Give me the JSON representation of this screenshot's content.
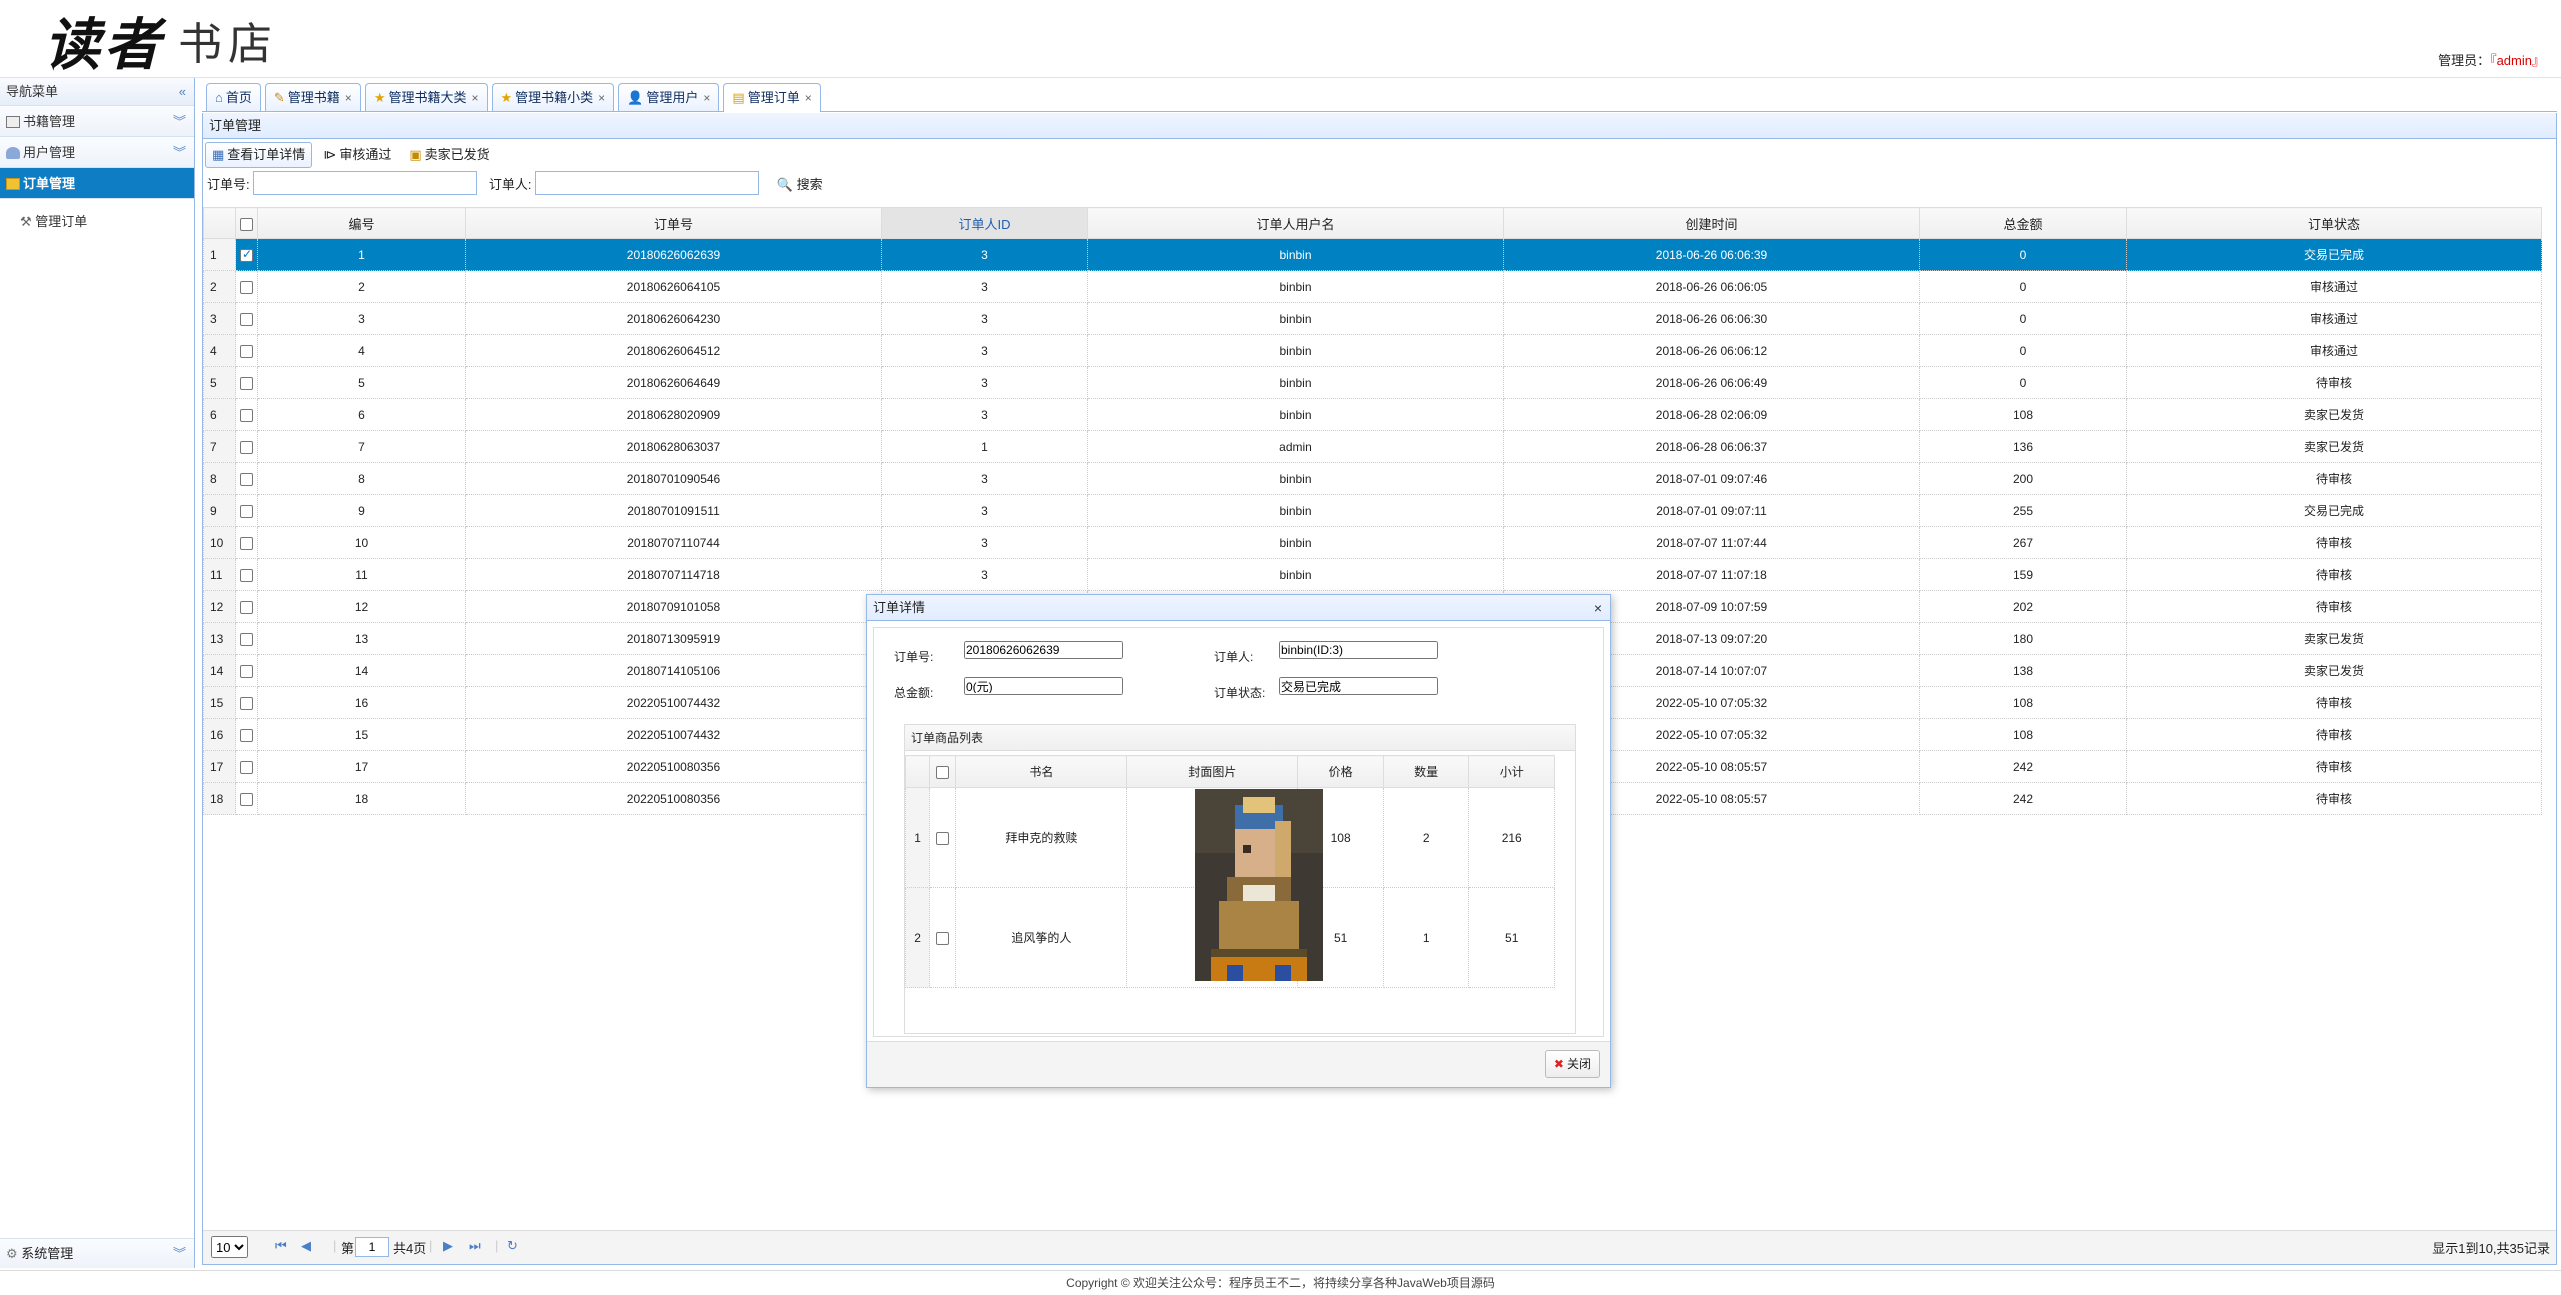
{
  "header": {
    "logo_script": "读者",
    "logo_text": "书店",
    "admin_label": "管理员：",
    "admin_name": "『admin』"
  },
  "nav": {
    "title": "导航菜单",
    "collapse_icon": "double-left-chevron-icon",
    "items": [
      {
        "label": "书籍管理",
        "icon": "book-icon",
        "active": false
      },
      {
        "label": "用户管理",
        "icon": "user-icon",
        "active": false
      },
      {
        "label": "订单管理",
        "icon": "folder-icon",
        "active": true
      }
    ],
    "sub_items": [
      {
        "label": "管理订单",
        "icon": "wrench-icon"
      }
    ],
    "bottom": "系统管理"
  },
  "tabs": [
    {
      "label": "首页",
      "icon": "home-icon",
      "closable": false
    },
    {
      "label": "管理书籍",
      "icon": "book-icon",
      "closable": true
    },
    {
      "label": "管理书籍大类",
      "icon": "star-icon",
      "closable": true
    },
    {
      "label": "管理书籍小类",
      "icon": "star-icon",
      "closable": true
    },
    {
      "label": "管理用户",
      "icon": "user-icon",
      "closable": true
    },
    {
      "label": "管理订单",
      "icon": "folder-icon",
      "closable": true,
      "active": true
    }
  ],
  "panel": {
    "title": "订单管理",
    "toolbar": {
      "view_detail": "查看订单详情",
      "approve": "审核通过",
      "shipped": "卖家已发货"
    },
    "search": {
      "order_no_label": "订单号:",
      "order_no_value": "",
      "orderer_label": "订单人:",
      "orderer_value": "",
      "search_button": "搜索"
    }
  },
  "grid": {
    "columns": [
      "编号",
      "订单号",
      "订单人ID",
      "订单人用户名",
      "创建时间",
      "总金额",
      "订单状态"
    ],
    "sorted_column": "订单人ID",
    "rows": [
      {
        "rn": "1",
        "checked": true,
        "id": "1",
        "order_no": "20180626062639",
        "user_id": "3",
        "username": "binbin",
        "created": "2018-06-26 06:06:39",
        "total": "0",
        "status": "交易已完成"
      },
      {
        "rn": "2",
        "checked": false,
        "id": "2",
        "order_no": "20180626064105",
        "user_id": "3",
        "username": "binbin",
        "created": "2018-06-26 06:06:05",
        "total": "0",
        "status": "审核通过"
      },
      {
        "rn": "3",
        "checked": false,
        "id": "3",
        "order_no": "20180626064230",
        "user_id": "3",
        "username": "binbin",
        "created": "2018-06-26 06:06:30",
        "total": "0",
        "status": "审核通过"
      },
      {
        "rn": "4",
        "checked": false,
        "id": "4",
        "order_no": "20180626064512",
        "user_id": "3",
        "username": "binbin",
        "created": "2018-06-26 06:06:12",
        "total": "0",
        "status": "审核通过"
      },
      {
        "rn": "5",
        "checked": false,
        "id": "5",
        "order_no": "20180626064649",
        "user_id": "3",
        "username": "binbin",
        "created": "2018-06-26 06:06:49",
        "total": "0",
        "status": "待审核"
      },
      {
        "rn": "6",
        "checked": false,
        "id": "6",
        "order_no": "20180628020909",
        "user_id": "3",
        "username": "binbin",
        "created": "2018-06-28 02:06:09",
        "total": "108",
        "status": "卖家已发货"
      },
      {
        "rn": "7",
        "checked": false,
        "id": "7",
        "order_no": "20180628063037",
        "user_id": "1",
        "username": "admin",
        "created": "2018-06-28 06:06:37",
        "total": "136",
        "status": "卖家已发货"
      },
      {
        "rn": "8",
        "checked": false,
        "id": "8",
        "order_no": "20180701090546",
        "user_id": "3",
        "username": "binbin",
        "created": "2018-07-01 09:07:46",
        "total": "200",
        "status": "待审核"
      },
      {
        "rn": "9",
        "checked": false,
        "id": "9",
        "order_no": "20180701091511",
        "user_id": "3",
        "username": "binbin",
        "created": "2018-07-01 09:07:11",
        "total": "255",
        "status": "交易已完成"
      },
      {
        "rn": "10",
        "checked": false,
        "id": "10",
        "order_no": "20180707110744",
        "user_id": "3",
        "username": "binbin",
        "created": "2018-07-07 11:07:44",
        "total": "267",
        "status": "待审核"
      },
      {
        "rn": "11",
        "checked": false,
        "id": "11",
        "order_no": "20180707114718",
        "user_id": "3",
        "username": "binbin",
        "created": "2018-07-07 11:07:18",
        "total": "159",
        "status": "待审核"
      },
      {
        "rn": "12",
        "checked": false,
        "id": "12",
        "order_no": "20180709101058",
        "user_id": "",
        "username": "",
        "created": "2018-07-09 10:07:59",
        "total": "202",
        "status": "待审核"
      },
      {
        "rn": "13",
        "checked": false,
        "id": "13",
        "order_no": "20180713095919",
        "user_id": "",
        "username": "",
        "created": "2018-07-13 09:07:20",
        "total": "180",
        "status": "卖家已发货"
      },
      {
        "rn": "14",
        "checked": false,
        "id": "14",
        "order_no": "20180714105106",
        "user_id": "",
        "username": "",
        "created": "2018-07-14 10:07:07",
        "total": "138",
        "status": "卖家已发货"
      },
      {
        "rn": "15",
        "checked": false,
        "id": "16",
        "order_no": "20220510074432",
        "user_id": "",
        "username": "",
        "created": "2022-05-10 07:05:32",
        "total": "108",
        "status": "待审核"
      },
      {
        "rn": "16",
        "checked": false,
        "id": "15",
        "order_no": "20220510074432",
        "user_id": "",
        "username": "",
        "created": "2022-05-10 07:05:32",
        "total": "108",
        "status": "待审核"
      },
      {
        "rn": "17",
        "checked": false,
        "id": "17",
        "order_no": "20220510080356",
        "user_id": "",
        "username": "",
        "created": "2022-05-10 08:05:57",
        "total": "242",
        "status": "待审核"
      },
      {
        "rn": "18",
        "checked": false,
        "id": "18",
        "order_no": "20220510080356",
        "user_id": "",
        "username": "",
        "created": "2022-05-10 08:05:57",
        "total": "242",
        "status": "待审核"
      }
    ]
  },
  "pager": {
    "page_size": "10",
    "page_prefix": "第",
    "page_value": "1",
    "page_suffix": "共4页",
    "info": "显示1到10,共35记录"
  },
  "footer": "Copyright © 欢迎关注公众号：程序员王不二，将持续分享各种JavaWeb项目源码",
  "dialog": {
    "title": "订单详情",
    "order_no_label": "订单号:",
    "order_no": "20180626062639",
    "orderer_label": "订单人:",
    "orderer": "binbin(ID:3)",
    "total_label": "总金额:",
    "total": "0(元)",
    "status_label": "订单状态:",
    "status": "交易已完成",
    "items_title": "订单商品列表",
    "item_columns": [
      "书名",
      "封面图片",
      "价格",
      "数量",
      "小计"
    ],
    "items": [
      {
        "rn": "1",
        "name": "拜申克的救赎",
        "price": "108",
        "qty": "2",
        "subtotal": "216"
      },
      {
        "rn": "2",
        "name": "追风筝的人",
        "price": "51",
        "qty": "1",
        "subtotal": "51"
      }
    ],
    "close_button": "关闭"
  }
}
